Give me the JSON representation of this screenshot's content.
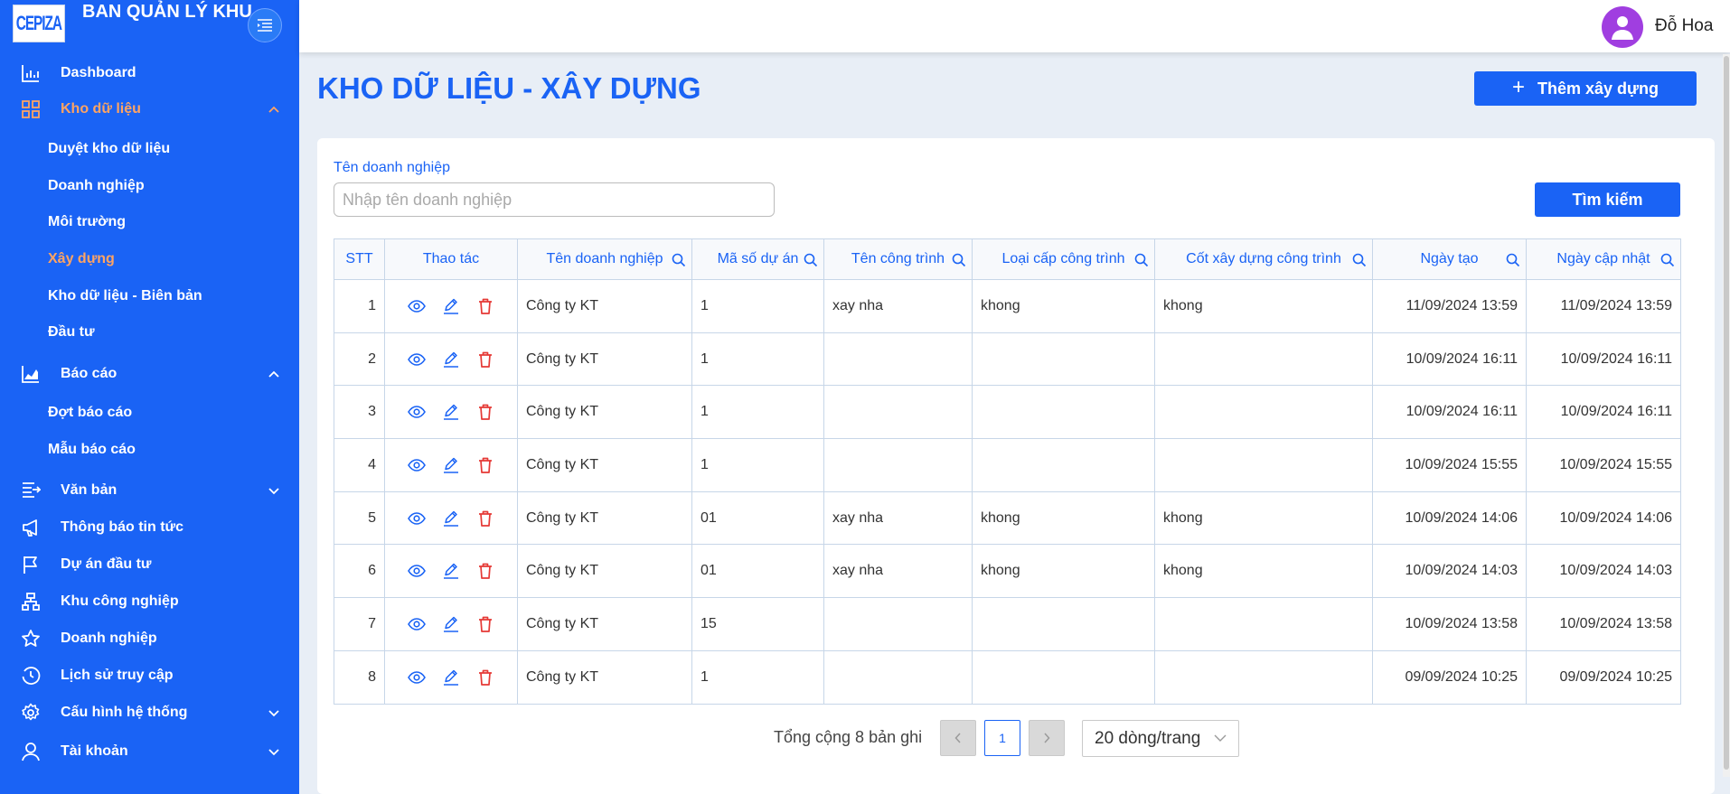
{
  "brand": {
    "logo_text": "CEPIZA",
    "title": "BAN QUẢN LÝ KHU CHẾ XUẤT KHU CN"
  },
  "user": {
    "name": "Đỗ Hoa"
  },
  "sidebar": {
    "dashboard": "Dashboard",
    "kho_du_lieu": "Kho dữ liệu",
    "kho_sub": [
      "Duyệt kho dữ liệu",
      "Doanh nghiệp",
      "Môi trường",
      "Xây dựng",
      "Kho dữ liệu - Biên bản",
      "Đầu tư"
    ],
    "bao_cao": "Báo cáo",
    "bao_cao_sub": [
      "Đợt báo cáo",
      "Mẫu báo cáo"
    ],
    "van_ban": "Văn bản",
    "thong_bao": "Thông báo tin tức",
    "du_an": "Dự án đầu tư",
    "khu_cn": "Khu công nghiệp",
    "doanh_nghiep": "Doanh nghiệp",
    "lich_su": "Lịch sử truy cập",
    "cau_hinh": "Cấu hình hệ thống",
    "tai_khoan": "Tài khoản"
  },
  "colors": {
    "primary": "#1a63f5",
    "active_menu": "#ffa463",
    "delete": "#e53935"
  },
  "page": {
    "title": "KHO DỮ LIỆU - XÂY DỰNG",
    "add_button": "Thêm xây dựng"
  },
  "filter": {
    "label": "Tên doanh nghiệp",
    "placeholder": "Nhập tên doanh nghiệp",
    "value": "",
    "search_button": "Tìm kiếm"
  },
  "table": {
    "headers": [
      "STT",
      "Thao tác",
      "Tên doanh nghiệp",
      "Mã số dự án",
      "Tên công trình",
      "Loại cấp công trình",
      "Cốt xây dựng công trình",
      "Ngày tạo",
      "Ngày cập nhật"
    ],
    "rows": [
      {
        "stt": "1",
        "ten_dn": "Công ty KT",
        "ma_du_an": "1",
        "ten_ct": "xay nha",
        "loai_cap": "khong",
        "cot_xd": "khong",
        "ngay_tao": "11/09/2024 13:59",
        "ngay_cap_nhat": "11/09/2024 13:59"
      },
      {
        "stt": "2",
        "ten_dn": "Công ty KT",
        "ma_du_an": "1",
        "ten_ct": "",
        "loai_cap": "",
        "cot_xd": "",
        "ngay_tao": "10/09/2024 16:11",
        "ngay_cap_nhat": "10/09/2024 16:11"
      },
      {
        "stt": "3",
        "ten_dn": "Công ty KT",
        "ma_du_an": "1",
        "ten_ct": "",
        "loai_cap": "",
        "cot_xd": "",
        "ngay_tao": "10/09/2024 16:11",
        "ngay_cap_nhat": "10/09/2024 16:11"
      },
      {
        "stt": "4",
        "ten_dn": "Công ty KT",
        "ma_du_an": "1",
        "ten_ct": "",
        "loai_cap": "",
        "cot_xd": "",
        "ngay_tao": "10/09/2024 15:55",
        "ngay_cap_nhat": "10/09/2024 15:55"
      },
      {
        "stt": "5",
        "ten_dn": "Công ty KT",
        "ma_du_an": "01",
        "ten_ct": "xay nha",
        "loai_cap": "khong",
        "cot_xd": "khong",
        "ngay_tao": "10/09/2024 14:06",
        "ngay_cap_nhat": "10/09/2024 14:06"
      },
      {
        "stt": "6",
        "ten_dn": "Công ty KT",
        "ma_du_an": "01",
        "ten_ct": "xay nha",
        "loai_cap": "khong",
        "cot_xd": "khong",
        "ngay_tao": "10/09/2024 14:03",
        "ngay_cap_nhat": "10/09/2024 14:03"
      },
      {
        "stt": "7",
        "ten_dn": "Công ty KT",
        "ma_du_an": "15",
        "ten_ct": "",
        "loai_cap": "",
        "cot_xd": "",
        "ngay_tao": "10/09/2024 13:58",
        "ngay_cap_nhat": "10/09/2024 13:58"
      },
      {
        "stt": "8",
        "ten_dn": "Công ty KT",
        "ma_du_an": "1",
        "ten_ct": "",
        "loai_cap": "",
        "cot_xd": "",
        "ngay_tao": "09/09/2024 10:25",
        "ngay_cap_nhat": "09/09/2024 10:25"
      }
    ]
  },
  "pagination": {
    "total": "Tổng cộng 8 bản ghi",
    "current_page": "1",
    "per_page": "20 dòng/trang"
  }
}
